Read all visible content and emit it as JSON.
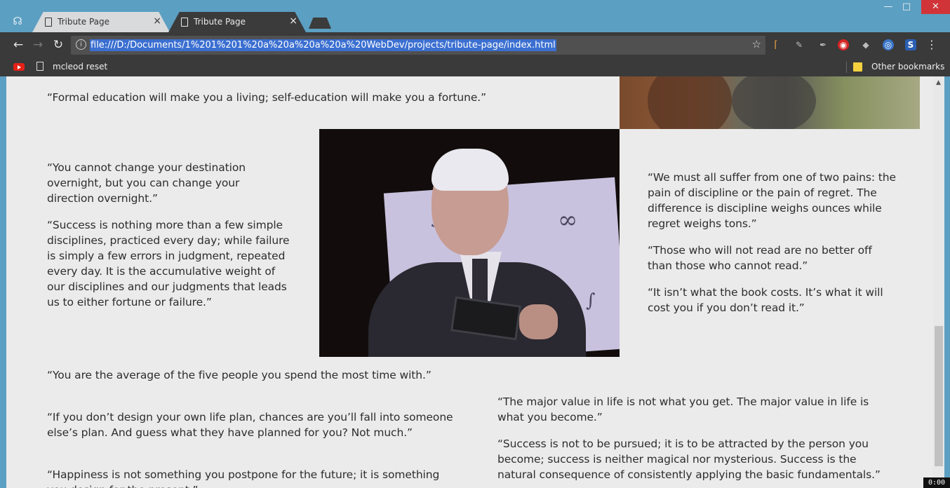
{
  "browser": {
    "tabs": [
      {
        "title": "Tribute Page",
        "active": true
      },
      {
        "title": "Tribute Page",
        "active": false
      }
    ],
    "url": "file:///D:/Documents/1%201%201%20a%20a%20a%20a%20WebDev/projects/tribute-page/index.html",
    "bookmarks": {
      "item": "mcleod reset",
      "other": "Other bookmarks"
    },
    "icons": {
      "back": "back-arrow-icon",
      "forward": "forward-arrow-icon",
      "reload": "reload-icon",
      "star": "star-icon",
      "menu": "menu-icon"
    },
    "recording_timer": "0:00"
  },
  "content": {
    "quotes": {
      "q1": "“Formal education will make you a living; self-education will make you a fortune.”",
      "q2": "“You cannot change your destination overnight, but you can change your direction overnight.”",
      "q3": "“Success is nothing more than a few simple disciplines, practiced every day; while failure is simply a few errors in judgment, repeated every day. It is the accumulative weight of our disciplines and our judgments that leads us to either fortune or failure.”",
      "q4": "“We must all suffer from one of two pains: the pain of discipline or the pain of regret. The difference is discipline weighs ounces while regret weighs tons.”",
      "q5": "“Those who will not read are no better off than those who cannot read.”",
      "q6": "“It isn’t what the book costs. It’s what it will cost you if you don’t read it.”",
      "q7": "“You are the average of the five people you spend the most time with.”",
      "q8": "“If you don’t design your own life plan, chances are you’ll fall into someone else’s plan. And guess what they have planned for you? Not much.”",
      "q9": "“Happiness is not something you postpone for the future; it is something you design for the present.”",
      "q10": "“The major value in life is not what you get. The major value in life is what you become.”",
      "q11": "“Success is not to be pursued; it is to be attracted by the person you become; success is neither magical nor mysterious. Success is the natural consequence of consistently applying the basic fundamentals.”"
    }
  },
  "colors": {
    "page_bg": "#ebebeb",
    "text": "#2d2d2d",
    "chrome_dark": "#3a3a3a",
    "window_frame": "#5b9fc2",
    "url_highlight": "#3b6fd0"
  }
}
